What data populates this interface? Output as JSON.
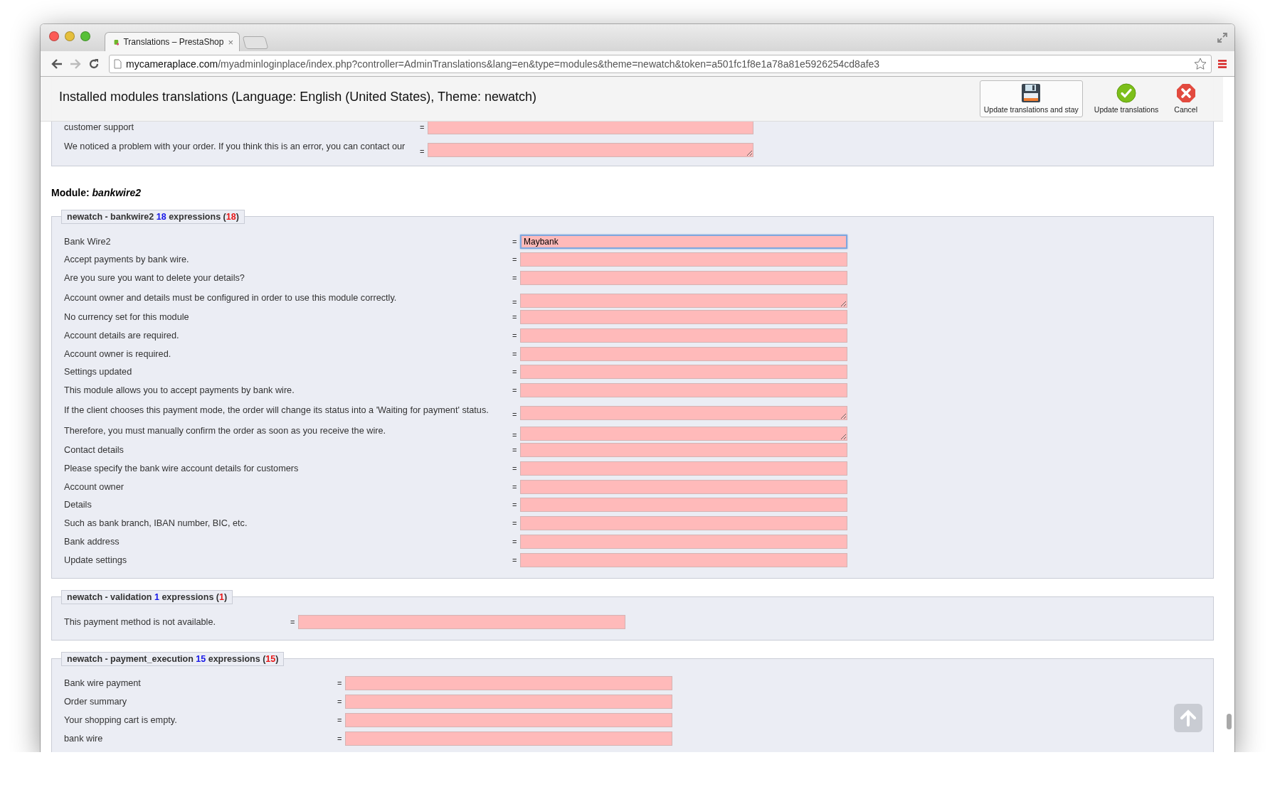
{
  "browser": {
    "tab": {
      "title": "Translations – PrestaShop",
      "close": "×"
    },
    "url": {
      "host": "mycameraplace.com",
      "path": "/myadminloginplace/index.php?controller=AdminTranslations&lang=en&type=modules&theme=newatch&token=a501fc1f8e1a78a81e5926254cd8afe3"
    }
  },
  "toolbar": {
    "title": "Installed modules translations (Language: English (United States), Theme: newatch)",
    "buttons": [
      {
        "label": "Update translations and stay",
        "kind": "save",
        "selected": true
      },
      {
        "label": "Update translations",
        "kind": "check",
        "selected": false
      },
      {
        "label": "Cancel",
        "kind": "cancel",
        "selected": false
      }
    ]
  },
  "previous_section": {
    "rows": [
      {
        "label": "customer support",
        "sign": "=",
        "kind": "input",
        "focused": false
      },
      {
        "label": "We noticed a problem with your order. If you think this is an error, you can contact our",
        "sign": "=",
        "kind": "textarea",
        "focused": false
      }
    ]
  },
  "module": {
    "heading": "Module: *bankwire2*",
    "groups": [
      {
        "legend": {
          "name": "newatch - bankwire2",
          "count": "18",
          "word": "expressions",
          "open": "(",
          "missing": "18",
          "close": ")"
        },
        "rows": [
          {
            "label": "Bank Wire2",
            "sign": "=",
            "kind": "input",
            "value": "Maybank",
            "focused": true
          },
          {
            "label": "Accept payments by bank wire.",
            "sign": "=",
            "kind": "input",
            "focused": false
          },
          {
            "label": "Are you sure you want to delete your details?",
            "sign": "=",
            "kind": "input",
            "focused": false
          },
          {
            "label": "Account owner and details must be configured in order to use this module correctly.",
            "sign": "=",
            "kind": "textarea",
            "focused": false
          },
          {
            "label": "No currency set for this module",
            "sign": "=",
            "kind": "input",
            "focused": false
          },
          {
            "label": "Account details are required.",
            "sign": "=",
            "kind": "input",
            "focused": false
          },
          {
            "label": "Account owner is required.",
            "sign": "=",
            "kind": "input",
            "focused": false
          },
          {
            "label": "Settings updated",
            "sign": "=",
            "kind": "input",
            "focused": false
          },
          {
            "label": "This module allows you to accept payments by bank wire.",
            "sign": "=",
            "kind": "input",
            "focused": false
          },
          {
            "label": "If the client chooses this payment mode, the order will change its status into a 'Waiting for payment' status.",
            "sign": "=",
            "kind": "textarea",
            "focused": false
          },
          {
            "label": "Therefore, you must manually confirm the order as soon as you receive the wire.",
            "sign": "=",
            "kind": "textarea",
            "focused": false
          },
          {
            "label": "Contact details",
            "sign": "=",
            "kind": "input",
            "focused": false
          },
          {
            "label": "Please specify the bank wire account details for customers",
            "sign": "=",
            "kind": "input",
            "focused": false
          },
          {
            "label": "Account owner",
            "sign": "=",
            "kind": "input",
            "focused": false
          },
          {
            "label": "Details",
            "sign": "=",
            "kind": "input",
            "focused": false
          },
          {
            "label": "Such as bank branch, IBAN number, BIC, etc.",
            "sign": "=",
            "kind": "input",
            "focused": false
          },
          {
            "label": "Bank address",
            "sign": "=",
            "kind": "input",
            "focused": false
          },
          {
            "label": "Update settings",
            "sign": "=",
            "kind": "input",
            "focused": false
          }
        ]
      },
      {
        "legend": {
          "name": "newatch - validation",
          "count": "1",
          "word": "expressions",
          "open": "(",
          "missing": "1",
          "close": ")"
        },
        "rows": [
          {
            "label": "This payment method is not available.",
            "sign": "=",
            "kind": "input",
            "focused": false
          }
        ]
      },
      {
        "legend": {
          "name": "newatch - payment_execution",
          "count": "15",
          "word": "expressions",
          "open": "(",
          "missing": "15",
          "close": ")"
        },
        "rows": [
          {
            "label": "Bank wire payment",
            "sign": "=",
            "kind": "input",
            "focused": false
          },
          {
            "label": "Order summary",
            "sign": "=",
            "kind": "input",
            "focused": false
          },
          {
            "label": "Your shopping cart is empty.",
            "sign": "=",
            "kind": "input",
            "focused": false
          },
          {
            "label": "bank wire",
            "sign": "=",
            "kind": "input",
            "focused": false
          }
        ]
      }
    ]
  }
}
